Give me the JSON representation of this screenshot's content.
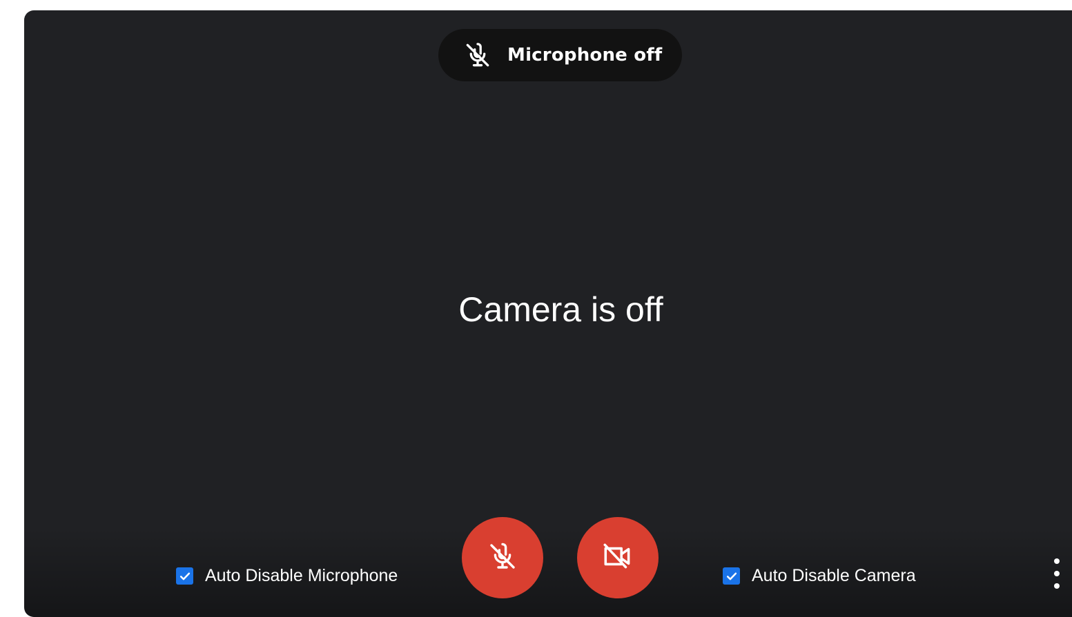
{
  "status_pill": {
    "icon": "mic-off-icon",
    "label": "Microphone off"
  },
  "camera_status": "Camera is off",
  "controls": {
    "mic_button": {
      "icon": "mic-off-icon",
      "state": "off",
      "color": "#d93f30"
    },
    "camera_button": {
      "icon": "camera-off-icon",
      "state": "off",
      "color": "#d93f30"
    }
  },
  "options": {
    "auto_disable_microphone": {
      "label": "Auto Disable Microphone",
      "checked": true
    },
    "auto_disable_camera": {
      "label": "Auto Disable Camera",
      "checked": true
    }
  },
  "more_button": {
    "icon": "more-vert-icon"
  },
  "colors": {
    "background": "#202124",
    "accent": "#1a73e8",
    "off_button": "#d93f30"
  }
}
